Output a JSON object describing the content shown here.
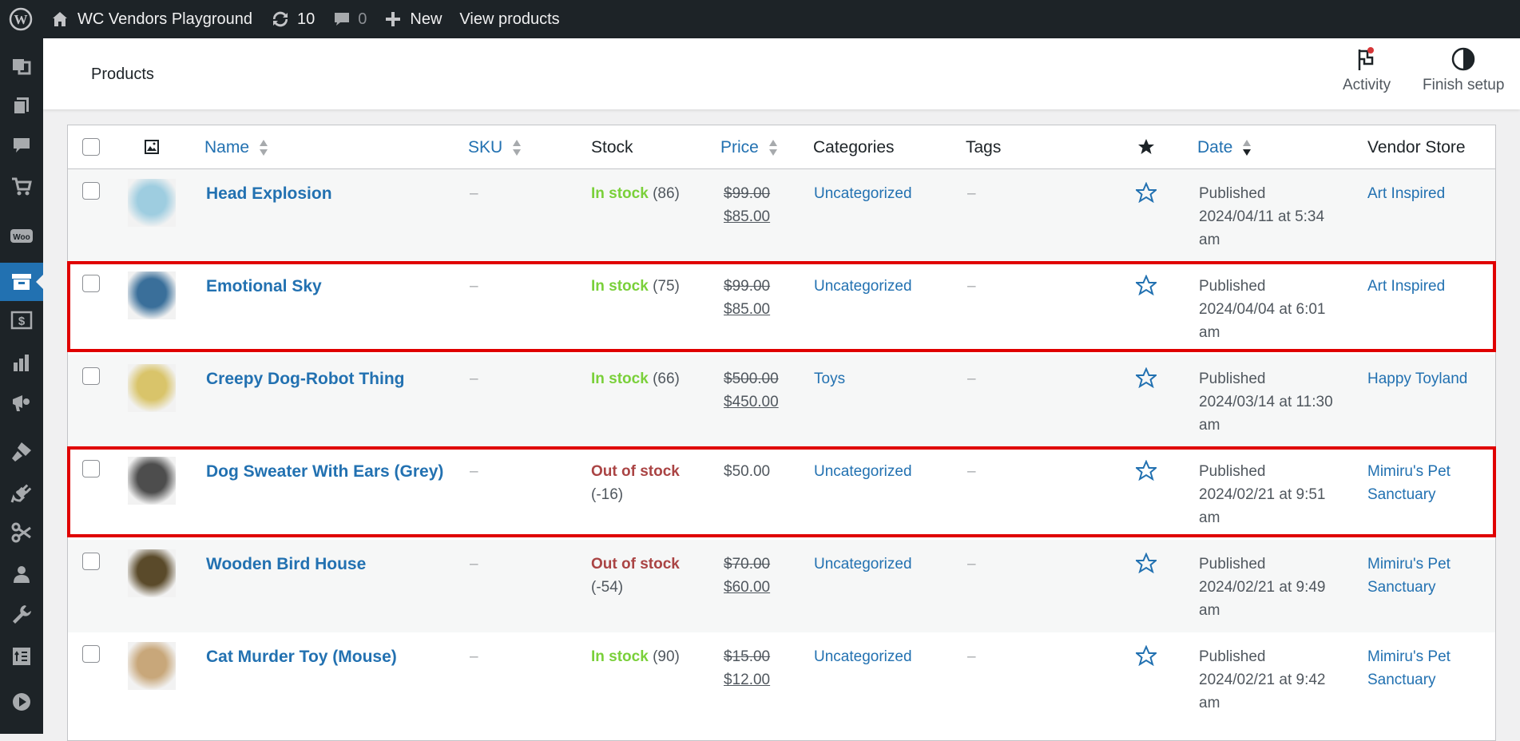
{
  "adminbar": {
    "site_name": "WC Vendors Playground",
    "updates_count": "10",
    "comments_count": "0",
    "new_label": "New",
    "view_products_label": "View products"
  },
  "sidebar": {
    "icons": [
      "dashboard-icon",
      "media-icon",
      "pages-icon",
      "comments-icon",
      "cart-icon",
      "woocommerce-icon",
      "products-icon",
      "payments-icon",
      "analytics-icon",
      "marketing-icon",
      "appearance-icon",
      "plugins-icon",
      "tools-scissors-icon",
      "users-icon",
      "settings-wrench-icon",
      "import-icon",
      "play-icon"
    ],
    "active": "products-icon"
  },
  "header": {
    "title": "Products",
    "activity_label": "Activity",
    "finish_setup_label": "Finish setup"
  },
  "table": {
    "columns": {
      "name": "Name",
      "sku": "SKU",
      "stock": "Stock",
      "price": "Price",
      "categories": "Categories",
      "tags": "Tags",
      "date": "Date",
      "vendor": "Vendor Store"
    },
    "rows": [
      {
        "name": "Head Explosion",
        "sku": "–",
        "stock_status": "In stock",
        "stock_qty": "(86)",
        "price_old": "$99.00",
        "price_new": "$85.00",
        "category": "Uncategorized",
        "tags": "–",
        "date_status": "Published",
        "date_line1": "2024/04/11 at 5:34",
        "date_line2": "am",
        "vendor_line1": "Art Inspired",
        "vendor_line2": "",
        "thumb_color": "#9ecde0",
        "stock_class": "in"
      },
      {
        "name": "Emotional Sky",
        "sku": "–",
        "stock_status": "In stock",
        "stock_qty": "(75)",
        "price_old": "$99.00",
        "price_new": "$85.00",
        "category": "Uncategorized",
        "tags": "–",
        "date_status": "Published",
        "date_line1": "2024/04/04 at 6:01",
        "date_line2": "am",
        "vendor_line1": "Art Inspired",
        "vendor_line2": "",
        "thumb_color": "#3a6f9a",
        "stock_class": "in"
      },
      {
        "name": "Creepy Dog-Robot Thing",
        "sku": "–",
        "stock_status": "In stock",
        "stock_qty": "(66)",
        "price_old": "$500.00",
        "price_new": "$450.00",
        "category": "Toys",
        "tags": "–",
        "date_status": "Published",
        "date_line1": "2024/03/14 at 11:30",
        "date_line2": "am",
        "vendor_line1": "Happy Toyland",
        "vendor_line2": "",
        "thumb_color": "#d9c46a",
        "stock_class": "in"
      },
      {
        "name": "Dog Sweater With Ears (Grey)",
        "sku": "–",
        "stock_status": "Out of stock",
        "stock_qty": "(-16)",
        "price_old": "",
        "price_new": "$50.00",
        "category": "Uncategorized",
        "tags": "–",
        "date_status": "Published",
        "date_line1": "2024/02/21 at 9:51",
        "date_line2": "am",
        "vendor_line1": "Mimiru's Pet",
        "vendor_line2": "Sanctuary",
        "thumb_color": "#4d4d4d",
        "stock_class": "out"
      },
      {
        "name": "Wooden Bird House",
        "sku": "–",
        "stock_status": "Out of stock",
        "stock_qty": "(-54)",
        "price_old": "$70.00",
        "price_new": "$60.00",
        "category": "Uncategorized",
        "tags": "–",
        "date_status": "Published",
        "date_line1": "2024/02/21 at 9:49",
        "date_line2": "am",
        "vendor_line1": "Mimiru's Pet",
        "vendor_line2": "Sanctuary",
        "thumb_color": "#5a4a2a",
        "stock_class": "out"
      },
      {
        "name": "Cat Murder Toy (Mouse)",
        "sku": "–",
        "stock_status": "In stock",
        "stock_qty": "(90)",
        "price_old": "$15.00",
        "price_new": "$12.00",
        "category": "Uncategorized",
        "tags": "–",
        "date_status": "Published",
        "date_line1": "2024/02/21 at 9:42",
        "date_line2": "am",
        "vendor_line1": "Mimiru's Pet",
        "vendor_line2": "Sanctuary",
        "thumb_color": "#c8a77a",
        "stock_class": "in"
      }
    ]
  },
  "colors": {
    "accent": "#2271b1",
    "in_stock": "#7ad03a",
    "out_of_stock": "#aa4444",
    "highlight": "#e00000"
  }
}
